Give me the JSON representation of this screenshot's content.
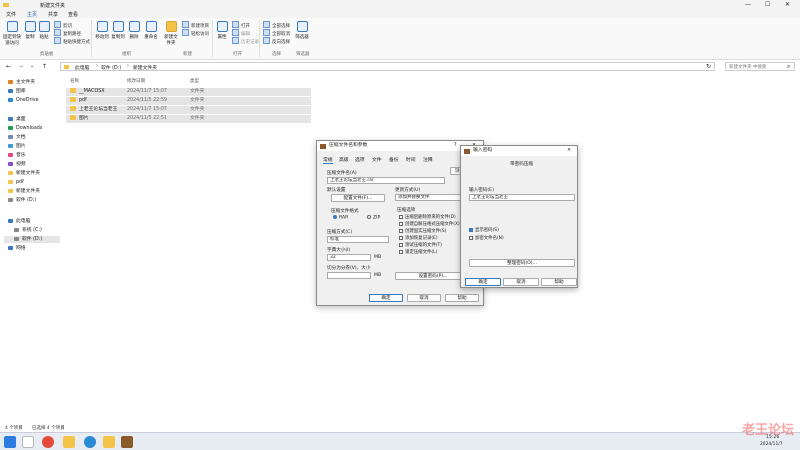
{
  "window": {
    "title": "新建文件夹"
  },
  "menu": [
    "文件",
    "主页",
    "共享",
    "查看"
  ],
  "ribbon": {
    "pin_label": "固定到快速访问",
    "copy_label": "复制",
    "paste_label": "粘贴",
    "cut_label": "剪切",
    "copy_path_label": "复制路径",
    "paste_shortcut_label": "粘贴快捷方式",
    "move_to_label": "移动到",
    "copy_to_label": "复制到",
    "delete_label": "删除",
    "rename_label": "重命名",
    "new_folder_label": "新建文件夹",
    "new_item_label": "新建项目",
    "easy_access_label": "轻松访问",
    "properties_label": "属性",
    "open_label": "打开",
    "edit_label": "编辑",
    "history_label": "历史记录",
    "select_all_label": "全部选择",
    "select_none_label": "全部取消",
    "invert_label": "反向选择",
    "filter_label": "筛选器",
    "groups": {
      "clipboard": "剪贴板",
      "organize": "组织",
      "new": "新建",
      "open": "打开",
      "select": "选择",
      "filter": "筛选器"
    }
  },
  "address": {
    "crumbs": [
      "此电脑",
      "软件 (D:)",
      "新建文件夹"
    ],
    "search_placeholder": "新建文件夹 中搜索"
  },
  "sidebar": {
    "items": [
      {
        "label": "主文件夹"
      },
      {
        "label": "图库"
      },
      {
        "label": "OneDrive"
      },
      {
        "label": "桌面"
      },
      {
        "label": "Downloads"
      },
      {
        "label": "文档"
      },
      {
        "label": "图片"
      },
      {
        "label": "音乐"
      },
      {
        "label": "视频"
      },
      {
        "label": "新建文件夹"
      },
      {
        "label": "pdf"
      },
      {
        "label": "新建文件夹"
      },
      {
        "label": "软件 (D:)"
      },
      {
        "label": "此电脑"
      },
      {
        "label": "系统 (C:)"
      },
      {
        "label": "软件 (D:)"
      },
      {
        "label": "网络"
      }
    ]
  },
  "columns": {
    "name": "名称",
    "date": "修改日期",
    "type": "类型"
  },
  "files": [
    {
      "name": "__MACOSX",
      "date": "2024/11/7 15:07",
      "type": "文件夹"
    },
    {
      "name": "pdf",
      "date": "2024/11/5 22:59",
      "type": "文件夹"
    },
    {
      "name": "上老王论坛当老王",
      "date": "2024/11/7 15:07",
      "type": "文件夹"
    },
    {
      "name": "图片",
      "date": "2024/11/5 22:51",
      "type": "文件夹"
    }
  ],
  "status": {
    "count": "4 个项目",
    "selected": "已选择 4 个项目"
  },
  "archive_dialog": {
    "title": "压缩文件名和参数",
    "tabs": [
      "常规",
      "高级",
      "选项",
      "文件",
      "备份",
      "时间",
      "注释"
    ],
    "archive_name_label": "压缩文件名(A)",
    "archive_name_value": "上老王论坛当老王.rar",
    "browse_label": "浏览(B)...",
    "default_settings_label": "默认设置",
    "profiles_label": "配置文件(F)...",
    "update_mode_label": "更新方式(U)",
    "update_mode_value": "添加并替换文件",
    "format_label": "压缩文件格式",
    "rar_label": "RAR",
    "zip_label": "ZIP",
    "method_label": "压缩方式(C)",
    "method_value": "标准",
    "dict_label": "字典大小(I)",
    "dict_value": "32",
    "dict_unit": "MB",
    "split_label": "切分为分卷(V)，大小",
    "split_unit": "MB",
    "options_label": "压缩选项",
    "options": [
      {
        "label": "压缩后删除原来的文件(D)",
        "checked": false
      },
      {
        "label": "创建自解压格式压缩文件(X)",
        "checked": false
      },
      {
        "label": "创建固实压缩文件(S)",
        "checked": false
      },
      {
        "label": "添加恢复记录(E)",
        "checked": false
      },
      {
        "label": "测试压缩的文件(T)",
        "checked": false
      },
      {
        "label": "锁定压缩文件(L)",
        "checked": false
      }
    ],
    "set_password_label": "设置密码(P)...",
    "ok_label": "确定",
    "cancel_label": "取消",
    "help_label": "帮助"
  },
  "password_dialog": {
    "title": "输入密码",
    "heading": "带密码压缩",
    "enter_label": "输入密码(E)",
    "enter_value": "上老王论坛当老王",
    "show_password_label": "显示密码(S)",
    "encrypt_names_label": "加密文件名(N)",
    "organize_label": "整理密码(O)...",
    "ok_label": "确定",
    "cancel_label": "取消",
    "help_label": "帮助"
  },
  "taskbar": {
    "time": "15:26",
    "date": "2024/11/7"
  },
  "watermark": "老王论坛",
  "colors": {
    "accent": "#3b78c3",
    "folder": "#f4c34a",
    "selection": "#e5e5e5"
  }
}
